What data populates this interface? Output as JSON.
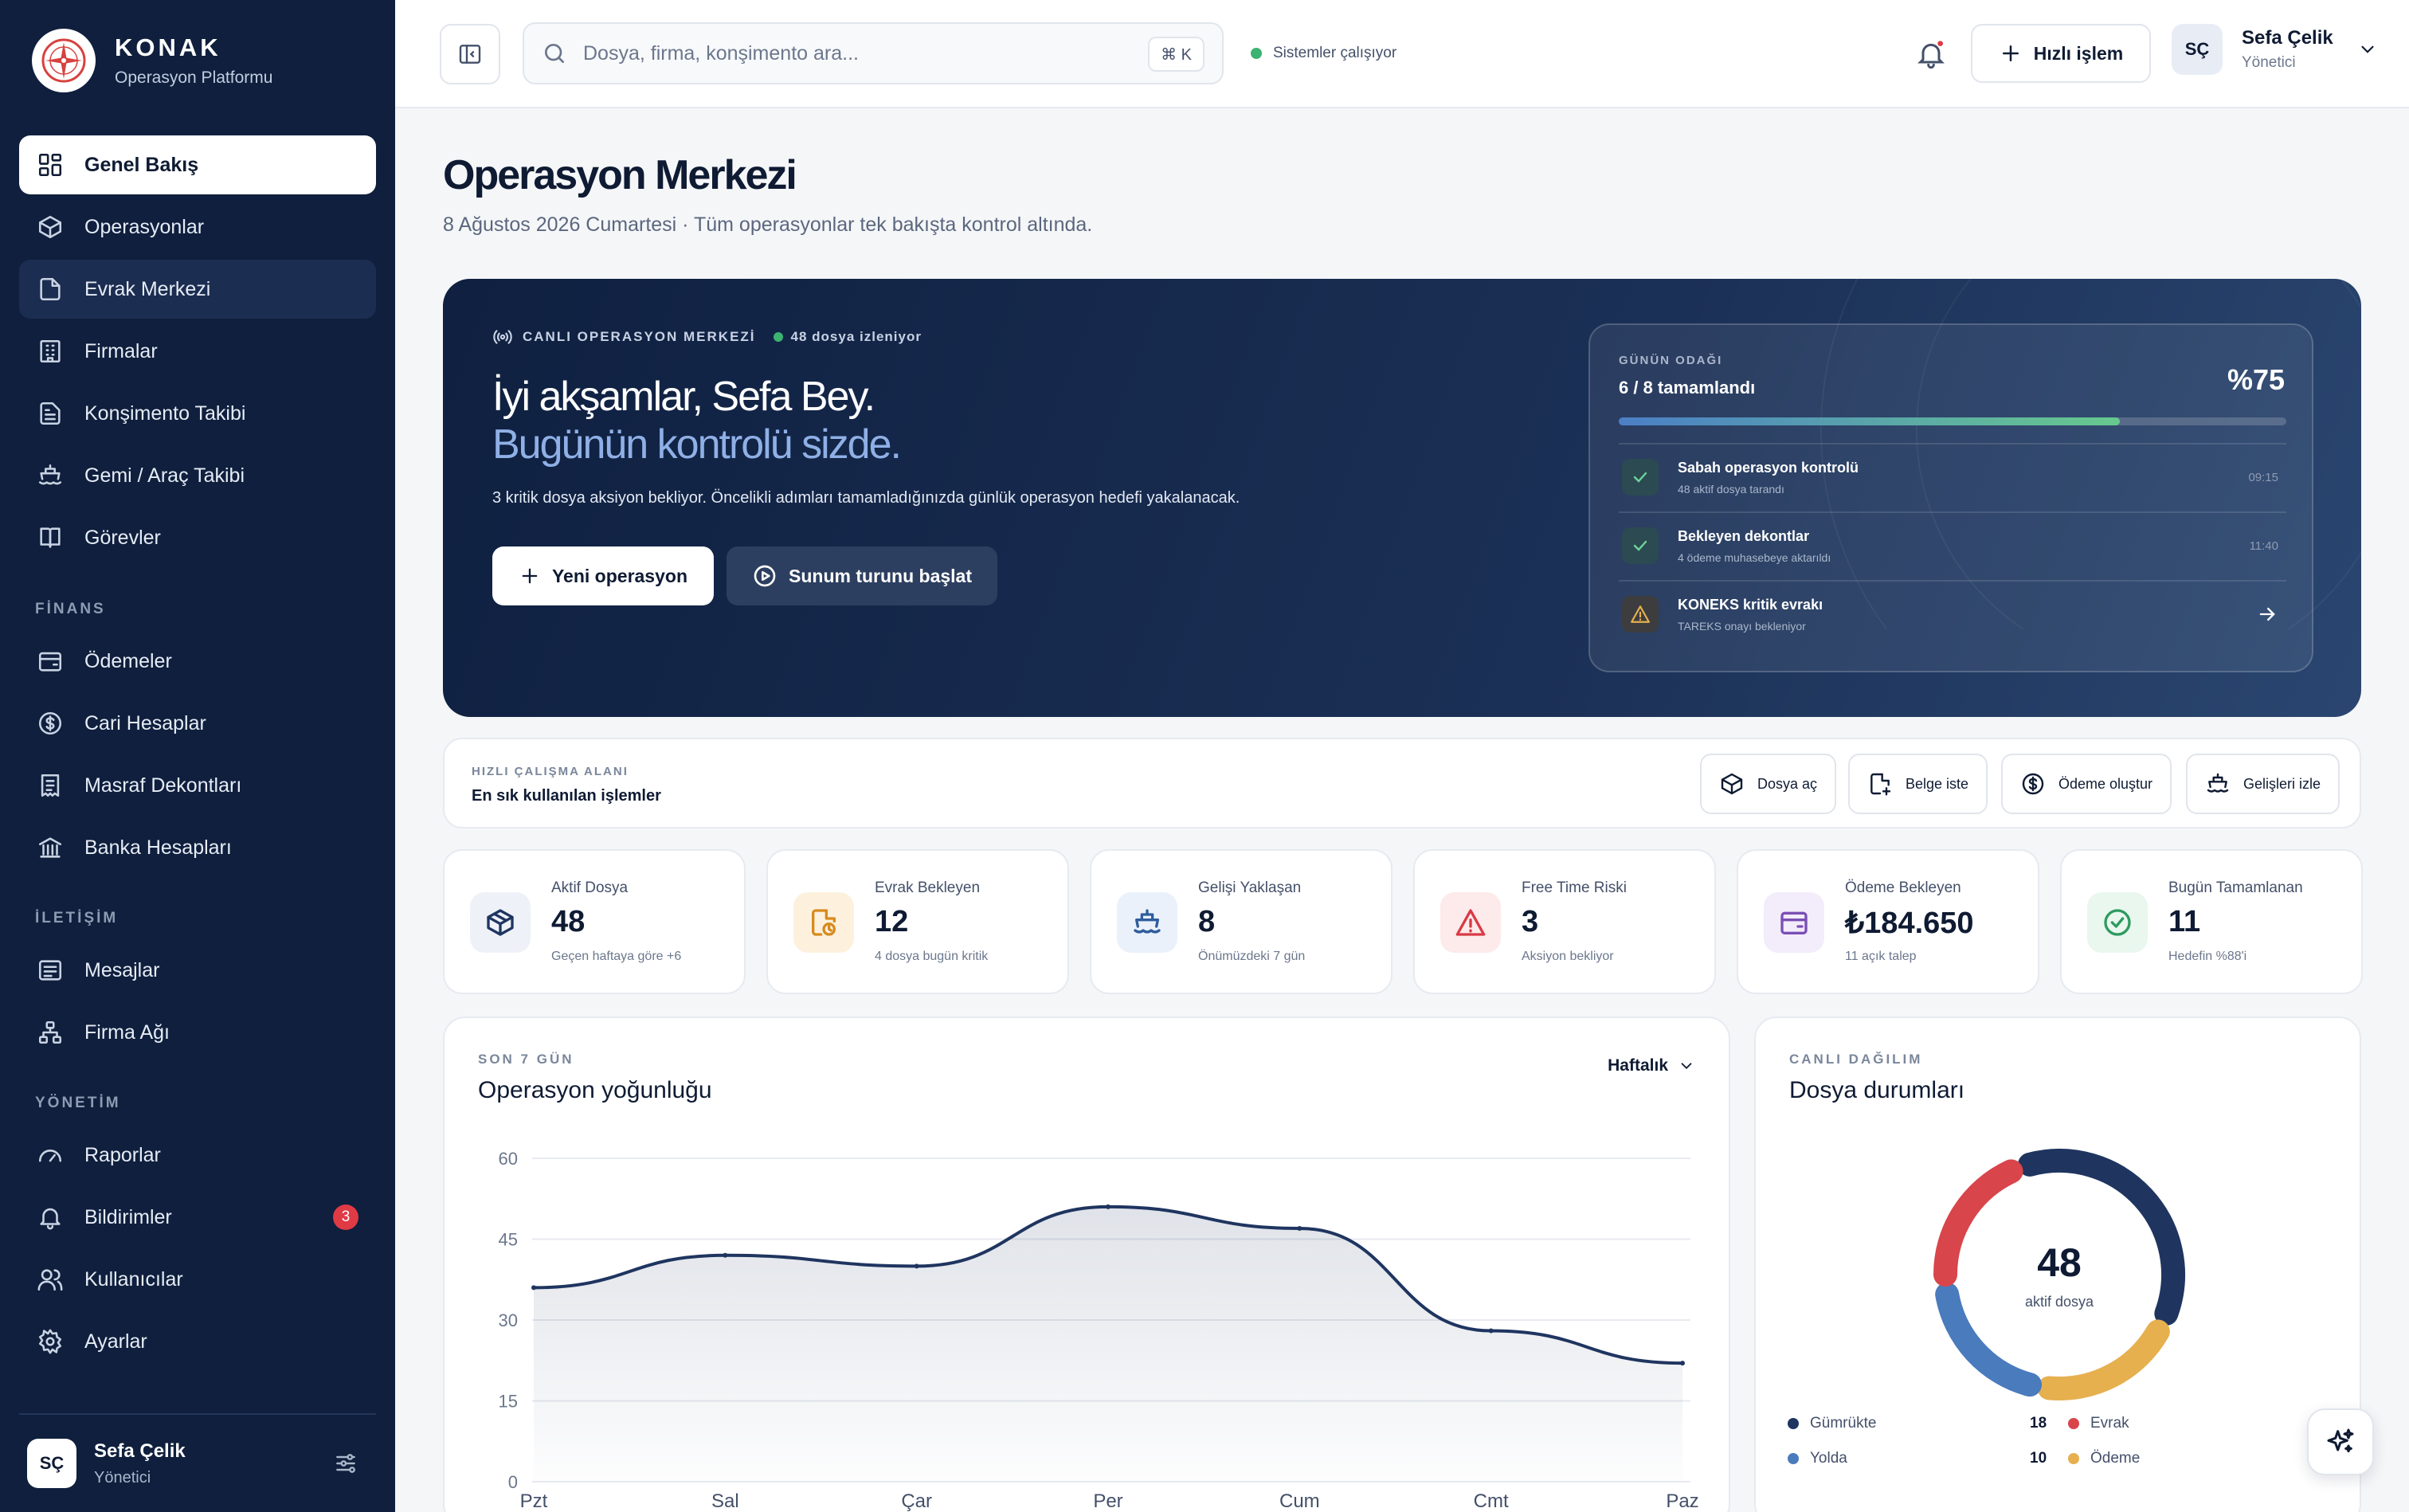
{
  "brand": {
    "title": "KONAK",
    "subtitle": "Operasyon Platformu"
  },
  "sidebar": {
    "items": [
      {
        "label": "Genel Bakış",
        "icon": "grid-icon"
      },
      {
        "label": "Operasyonlar",
        "icon": "box-icon"
      },
      {
        "label": "Evrak Merkezi",
        "icon": "document-icon"
      },
      {
        "label": "Firmalar",
        "icon": "building-icon"
      },
      {
        "label": "Konşimento Takibi",
        "icon": "file-text-icon"
      },
      {
        "label": "Gemi / Araç Takibi",
        "icon": "ship-icon"
      },
      {
        "label": "Görevler",
        "icon": "book-icon"
      }
    ],
    "sections": {
      "finance": "FİNANS",
      "communication": "İLETİŞİM",
      "management": "YÖNETİM"
    },
    "finance_items": [
      {
        "label": "Ödemeler",
        "icon": "wallet-icon"
      },
      {
        "label": "Cari Hesaplar",
        "icon": "dollar-circle-icon"
      },
      {
        "label": "Masraf Dekontları",
        "icon": "receipt-icon"
      },
      {
        "label": "Banka Hesapları",
        "icon": "bank-icon"
      }
    ],
    "communication_items": [
      {
        "label": "Mesajlar",
        "icon": "message-icon"
      },
      {
        "label": "Firma Ağı",
        "icon": "network-icon"
      }
    ],
    "management_items": [
      {
        "label": "Raporlar",
        "icon": "gauge-icon"
      },
      {
        "label": "Bildirimler",
        "icon": "bell-icon",
        "badge": "3"
      },
      {
        "label": "Kullanıcılar",
        "icon": "users-icon"
      },
      {
        "label": "Ayarlar",
        "icon": "gear-icon"
      }
    ],
    "user": {
      "initials": "SÇ",
      "name": "Sefa Çelik",
      "role": "Yönetici"
    }
  },
  "topbar": {
    "search_placeholder": "Dosya, firma, konşimento ara...",
    "shortcut": "⌘ K",
    "status": "Sistemler çalışıyor",
    "quick_action": "Hızlı işlem",
    "user": {
      "initials": "SÇ",
      "name": "Sefa Çelik",
      "role": "Yönetici"
    }
  },
  "page": {
    "title": "Operasyon Merkezi",
    "subtitle": "8 Ağustos 2026 Cumartesi · Tüm operasyonlar tek bakışta kontrol altında."
  },
  "hero": {
    "live_label": "CANLI OPERASYON MERKEZİ",
    "tracking": "48 dosya izleniyor",
    "greeting": "İyi akşamlar, Sefa Bey.",
    "tagline": "Bugünün kontrolü sizde.",
    "description": "3 kritik dosya aksiyon bekliyor. Öncelikli adımları tamamladığınızda günlük operasyon hedefi yakalanacak.",
    "primary_button": "Yeni operasyon",
    "secondary_button": "Sunum turunu başlat",
    "goal": {
      "label": "GÜNÜN ODAĞI",
      "value": "6 / 8 tamamlandı",
      "percent_text": "%75",
      "progress": 0.75,
      "tasks": [
        {
          "title": "Sabah operasyon kontrolü",
          "subtitle": "48 aktif dosya tarandı",
          "time": "09:15",
          "status": "done"
        },
        {
          "title": "Bekleyen dekontlar",
          "subtitle": "4 ödeme muhasebeye aktarıldı",
          "time": "11:40",
          "status": "done"
        },
        {
          "title": "KONEKS kritik evrakı",
          "subtitle": "TAREKS onayı bekleniyor",
          "time": "",
          "status": "warning"
        }
      ]
    }
  },
  "quick_work": {
    "label": "HIZLI ÇALIŞMA ALANI",
    "title": "En sık kullanılan işlemler",
    "buttons": [
      "Dosya aç",
      "Belge iste",
      "Ödeme oluştur",
      "Gelişleri izle"
    ]
  },
  "stats": [
    {
      "label": "Aktif Dosya",
      "value": "48",
      "sub": "Geçen haftaya göre +6",
      "color": "#1f3560",
      "bg": "#eef2f8"
    },
    {
      "label": "Evrak Bekleyen",
      "value": "12",
      "sub": "4 dosya bugün kritik",
      "color": "#d88a1e",
      "bg": "#fdf1de"
    },
    {
      "label": "Gelişi Yaklaşan",
      "value": "8",
      "sub": "Önümüzdeki 7 gün",
      "color": "#2f5d9c",
      "bg": "#eaf1fb"
    },
    {
      "label": "Free Time Riski",
      "value": "3",
      "sub": "Aksiyon bekliyor",
      "color": "#d83a45",
      "bg": "#fdeaea"
    },
    {
      "label": "Ödeme Bekleyen",
      "value": "₺184.650",
      "sub": "11 açık talep",
      "color": "#7a4fb5",
      "bg": "#f3ecfb"
    },
    {
      "label": "Bugün Tamamlanan",
      "value": "11",
      "sub": "Hedefin %88'i",
      "color": "#2e9a5e",
      "bg": "#e9f7ef"
    }
  ],
  "density": {
    "kicker": "SON 7 GÜN",
    "title": "Operasyon yoğunluğu",
    "period": "Haftalık"
  },
  "distribution": {
    "kicker": "CANLI DAĞILIM",
    "title": "Dosya durumları",
    "center_value": "48",
    "center_label": "aktif dosya"
  },
  "chart_data": [
    {
      "type": "area",
      "categories": [
        "Pzt",
        "Sal",
        "Çar",
        "Per",
        "Cum",
        "Cmt",
        "Paz"
      ],
      "values": [
        36,
        42,
        40,
        51,
        47,
        28,
        22
      ],
      "ylim": [
        0,
        60
      ],
      "yticks": [
        0,
        15,
        30,
        45,
        60
      ],
      "grid": true,
      "color": "#1f3560"
    },
    {
      "type": "pie",
      "categories": [
        "Gümrükte",
        "Evrak",
        "Yolda",
        "Ödeme"
      ],
      "values": [
        18,
        10,
        10,
        10
      ],
      "colors": [
        "#1f3560",
        "#d8454b",
        "#4a7bbd",
        "#e6b04f"
      ],
      "value_labels": [
        "18",
        "10"
      ]
    }
  ]
}
